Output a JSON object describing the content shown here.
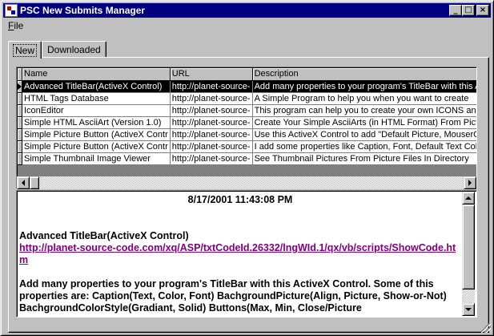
{
  "window": {
    "title": "PSC New Submits Manager",
    "controls": {
      "minimize": "_",
      "maximize": "□",
      "close": "×"
    }
  },
  "menu": [
    {
      "label": "File",
      "accel": "F",
      "rest": "ile"
    }
  ],
  "tabs": [
    {
      "label": "New",
      "active": true
    },
    {
      "label": "Downloaded",
      "active": false
    }
  ],
  "grid": {
    "columns": [
      "Name",
      "URL",
      "Description"
    ],
    "rows": [
      {
        "name": "Advanced TitleBar(ActiveX Control)",
        "url": "http://planet-source-",
        "desc": "Add many properties to your program's TitleBar with this A",
        "selected": true
      },
      {
        "name": "HTML Tags Database",
        "url": "http://planet-source-",
        "desc": "A Simple Program to help you when you want to create",
        "selected": false
      },
      {
        "name": "IconEditor",
        "url": "http://planet-source-",
        "desc": "This program can help you to create your own ICONS an",
        "selected": false
      },
      {
        "name": "Simple HTML AsciiArt (Version 1.0)",
        "url": "http://planet-source-",
        "desc": "Create Your Simple AsciiArts (in HTML Format) From Pictu",
        "selected": false
      },
      {
        "name": "Simple Picture Button (ActiveX Contr",
        "url": "http://planet-source-",
        "desc": "Use this ActiveX Control to add \"Default Picture, MouserO",
        "selected": false
      },
      {
        "name": "Simple Picture Button (ActiveX Contr",
        "url": "http://planet-source-",
        "desc": "I add some properties like Caption, Font, Default Text Colo",
        "selected": false
      },
      {
        "name": "Simple Thumbnail Image Viewer",
        "url": "http://planet-source-",
        "desc": "See Thumbnail Pictures From Picture Files In Directory",
        "selected": false
      }
    ]
  },
  "detail": {
    "date": "8/17/2001 11:43:08 PM",
    "title": "Advanced TitleBar(ActiveX Control)",
    "link": "http://planet-source-code.com/xq/ASP/txtCodeId.26332/lngWId.1/qx/vb/scripts/ShowCode.htm",
    "description": "Add many properties to your program's TitleBar with this ActiveX Control. Some of this properties are: Caption(Text, Color, Font) BachgroundPicture(Align, Picture, Show-or-Not) BachgroundColorStyle(Gradiant, Solid) Buttons(Max, Min, Close/Picture"
  },
  "colors": {
    "titlebar": "#000080",
    "face": "#c0c0c0",
    "link": "#800080",
    "selection": "#000000"
  }
}
